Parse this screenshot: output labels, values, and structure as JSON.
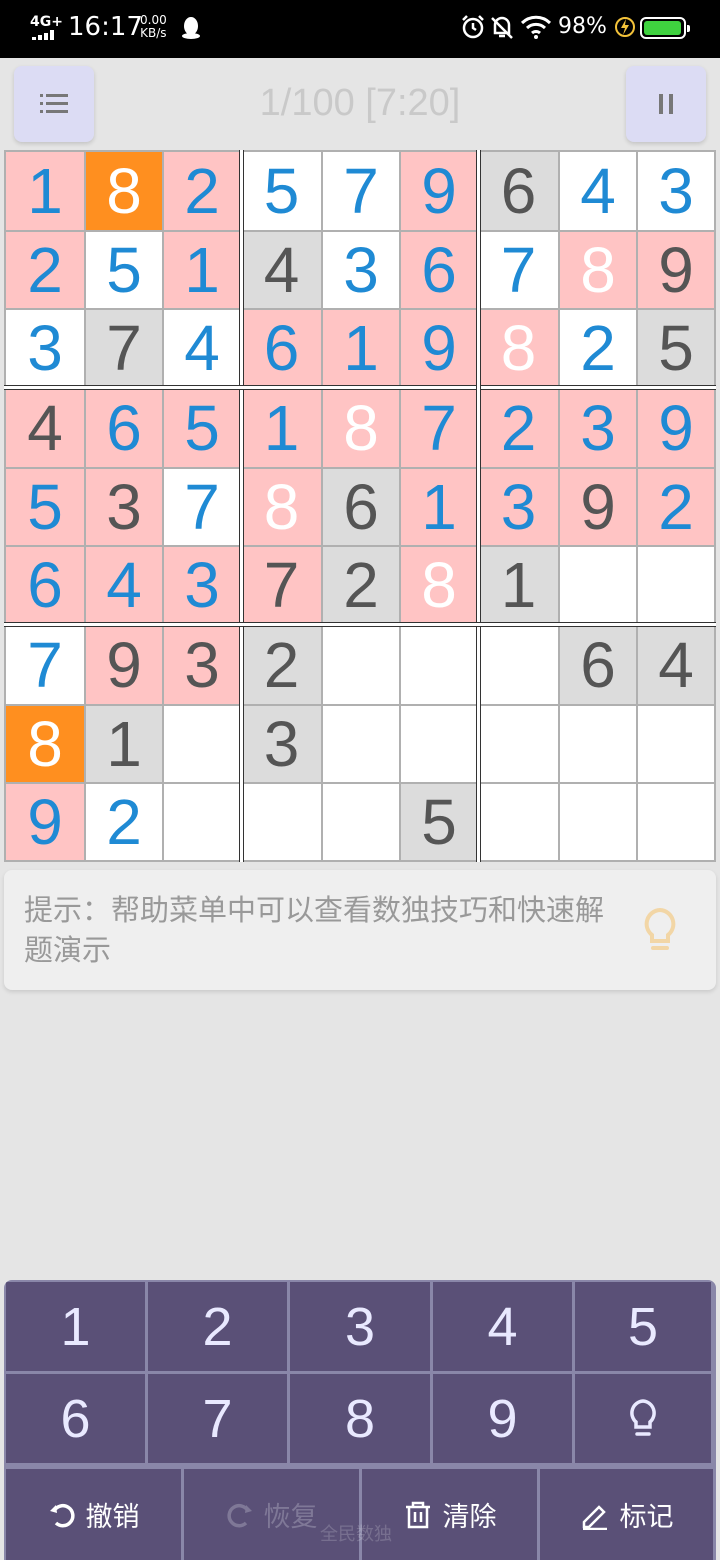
{
  "status_bar": {
    "network": "4G+",
    "time": "16:17",
    "speed_value": "0.00",
    "speed_unit": "KB/s",
    "battery_percent": "98%",
    "battery_level": 0.98
  },
  "header": {
    "title": "1/100 [7:20]",
    "menu_icon": "list-icon",
    "pause_icon": "pause-icon"
  },
  "colors": {
    "given_digit": "#555555",
    "user_digit": "#1f8ad4",
    "conflict_digit": "#ffffff",
    "cell_white": "#ffffff",
    "cell_gray": "#dcdcdc",
    "cell_pink": "#ffc4c4",
    "cell_orange": "#ff8f1f",
    "keypad": "#5a5077"
  },
  "grid": {
    "rows": [
      [
        {
          "v": "1",
          "t": "user",
          "bg": "pink"
        },
        {
          "v": "8",
          "t": "conflict",
          "bg": "orange"
        },
        {
          "v": "2",
          "t": "user",
          "bg": "pink"
        },
        {
          "v": "5",
          "t": "user",
          "bg": "white"
        },
        {
          "v": "7",
          "t": "user",
          "bg": "white"
        },
        {
          "v": "9",
          "t": "user",
          "bg": "pink"
        },
        {
          "v": "6",
          "t": "given",
          "bg": "gray"
        },
        {
          "v": "4",
          "t": "user",
          "bg": "white"
        },
        {
          "v": "3",
          "t": "user",
          "bg": "white"
        }
      ],
      [
        {
          "v": "2",
          "t": "user",
          "bg": "pink"
        },
        {
          "v": "5",
          "t": "user",
          "bg": "white"
        },
        {
          "v": "1",
          "t": "user",
          "bg": "pink"
        },
        {
          "v": "4",
          "t": "given",
          "bg": "gray"
        },
        {
          "v": "3",
          "t": "user",
          "bg": "white"
        },
        {
          "v": "6",
          "t": "user",
          "bg": "pink"
        },
        {
          "v": "7",
          "t": "user",
          "bg": "white"
        },
        {
          "v": "8",
          "t": "conflict",
          "bg": "pink"
        },
        {
          "v": "9",
          "t": "given",
          "bg": "pink"
        }
      ],
      [
        {
          "v": "3",
          "t": "user",
          "bg": "white"
        },
        {
          "v": "7",
          "t": "given",
          "bg": "gray"
        },
        {
          "v": "4",
          "t": "user",
          "bg": "white"
        },
        {
          "v": "6",
          "t": "user",
          "bg": "pink"
        },
        {
          "v": "1",
          "t": "user",
          "bg": "pink"
        },
        {
          "v": "9",
          "t": "user",
          "bg": "pink"
        },
        {
          "v": "8",
          "t": "conflict",
          "bg": "pink"
        },
        {
          "v": "2",
          "t": "user",
          "bg": "white"
        },
        {
          "v": "5",
          "t": "given",
          "bg": "gray"
        }
      ],
      [
        {
          "v": "4",
          "t": "given",
          "bg": "pink"
        },
        {
          "v": "6",
          "t": "user",
          "bg": "pink"
        },
        {
          "v": "5",
          "t": "user",
          "bg": "pink"
        },
        {
          "v": "1",
          "t": "user",
          "bg": "pink"
        },
        {
          "v": "8",
          "t": "conflict",
          "bg": "pink"
        },
        {
          "v": "7",
          "t": "user",
          "bg": "pink"
        },
        {
          "v": "2",
          "t": "user",
          "bg": "pink"
        },
        {
          "v": "3",
          "t": "user",
          "bg": "pink"
        },
        {
          "v": "9",
          "t": "user",
          "bg": "pink"
        }
      ],
      [
        {
          "v": "5",
          "t": "user",
          "bg": "pink"
        },
        {
          "v": "3",
          "t": "given",
          "bg": "pink"
        },
        {
          "v": "7",
          "t": "user",
          "bg": "white"
        },
        {
          "v": "8",
          "t": "conflict",
          "bg": "pink"
        },
        {
          "v": "6",
          "t": "given",
          "bg": "gray"
        },
        {
          "v": "1",
          "t": "user",
          "bg": "pink"
        },
        {
          "v": "3",
          "t": "user",
          "bg": "pink"
        },
        {
          "v": "9",
          "t": "given",
          "bg": "pink"
        },
        {
          "v": "2",
          "t": "user",
          "bg": "pink"
        }
      ],
      [
        {
          "v": "6",
          "t": "user",
          "bg": "pink"
        },
        {
          "v": "4",
          "t": "user",
          "bg": "pink"
        },
        {
          "v": "3",
          "t": "user",
          "bg": "pink"
        },
        {
          "v": "7",
          "t": "given",
          "bg": "pink"
        },
        {
          "v": "2",
          "t": "given",
          "bg": "gray"
        },
        {
          "v": "8",
          "t": "conflict",
          "bg": "pink"
        },
        {
          "v": "1",
          "t": "given",
          "bg": "gray"
        },
        {
          "v": "",
          "t": "user",
          "bg": "white"
        },
        {
          "v": "",
          "t": "user",
          "bg": "white"
        }
      ],
      [
        {
          "v": "7",
          "t": "user",
          "bg": "white"
        },
        {
          "v": "9",
          "t": "given",
          "bg": "pink"
        },
        {
          "v": "3",
          "t": "given",
          "bg": "pink"
        },
        {
          "v": "2",
          "t": "given",
          "bg": "gray"
        },
        {
          "v": "",
          "t": "user",
          "bg": "white"
        },
        {
          "v": "",
          "t": "user",
          "bg": "white"
        },
        {
          "v": "",
          "t": "user",
          "bg": "white"
        },
        {
          "v": "6",
          "t": "given",
          "bg": "gray"
        },
        {
          "v": "4",
          "t": "given",
          "bg": "gray"
        }
      ],
      [
        {
          "v": "8",
          "t": "conflict",
          "bg": "orange"
        },
        {
          "v": "1",
          "t": "given",
          "bg": "gray"
        },
        {
          "v": "",
          "t": "user",
          "bg": "white"
        },
        {
          "v": "3",
          "t": "given",
          "bg": "gray"
        },
        {
          "v": "",
          "t": "user",
          "bg": "white"
        },
        {
          "v": "",
          "t": "user",
          "bg": "white"
        },
        {
          "v": "",
          "t": "user",
          "bg": "white"
        },
        {
          "v": "",
          "t": "user",
          "bg": "white"
        },
        {
          "v": "",
          "t": "user",
          "bg": "white"
        }
      ],
      [
        {
          "v": "9",
          "t": "user",
          "bg": "pink"
        },
        {
          "v": "2",
          "t": "user",
          "bg": "white"
        },
        {
          "v": "",
          "t": "user",
          "bg": "white"
        },
        {
          "v": "",
          "t": "user",
          "bg": "white"
        },
        {
          "v": "",
          "t": "user",
          "bg": "white"
        },
        {
          "v": "5",
          "t": "given",
          "bg": "gray"
        },
        {
          "v": "",
          "t": "user",
          "bg": "white"
        },
        {
          "v": "",
          "t": "user",
          "bg": "white"
        },
        {
          "v": "",
          "t": "user",
          "bg": "white"
        }
      ]
    ]
  },
  "tip": {
    "text": "提示：帮助菜单中可以查看数独技巧和快速解题演示",
    "icon": "lightbulb-icon"
  },
  "keypad": {
    "numbers": [
      "1",
      "2",
      "3",
      "4",
      "5",
      "6",
      "7",
      "8",
      "9"
    ],
    "hint_icon": "lightbulb-icon"
  },
  "actions": [
    {
      "label": "撤销",
      "icon": "undo-icon",
      "enabled": true
    },
    {
      "label": "恢复",
      "icon": "redo-icon",
      "enabled": false
    },
    {
      "label": "清除",
      "icon": "trash-icon",
      "enabled": true
    },
    {
      "label": "标记",
      "icon": "pencil-icon",
      "enabled": true
    }
  ],
  "watermark": "全民数独"
}
